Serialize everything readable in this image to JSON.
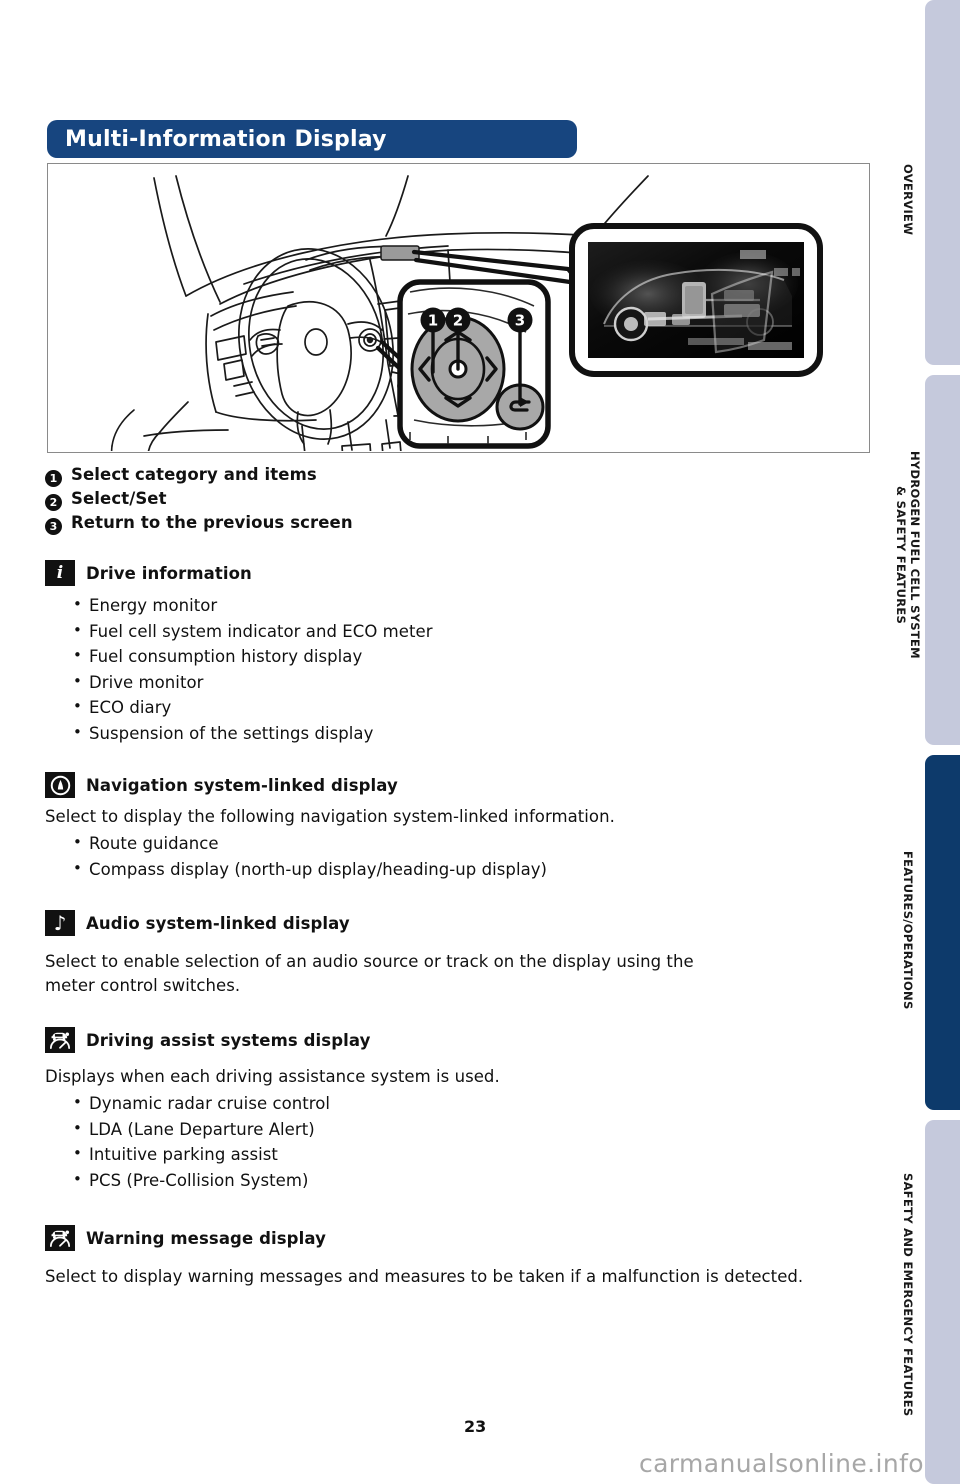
{
  "page": {
    "number": "23",
    "watermark": "carmanualsonline.info"
  },
  "header": {
    "title": "Multi-Information Display",
    "banner_color": "#17457f"
  },
  "figure": {
    "name": "instrument-panel-and-meter-control-switch-illustration",
    "callout_numbers": [
      "1",
      "2",
      "3"
    ],
    "screen_caption": "Energy monitor screen on multi-information display"
  },
  "callouts": [
    {
      "num": "1",
      "text": "Select category and items"
    },
    {
      "num": "2",
      "text": "Select/Set"
    },
    {
      "num": "3",
      "text": "Return to the previous screen"
    }
  ],
  "sections": [
    {
      "id": "drive-information",
      "icon": "info-icon",
      "icon_glyph": "i",
      "title": "Drive information",
      "paragraphs": [],
      "bullets": [
        "Energy monitor",
        "Fuel cell system indicator and ECO meter",
        "Fuel consumption history display",
        "Drive monitor",
        "ECO diary",
        "Suspension of the settings display"
      ]
    },
    {
      "id": "navigation-system-linked-display",
      "icon": "compass-icon",
      "icon_glyph": "",
      "title": "Navigation system-linked display",
      "paragraphs": [
        "Select to display the following navigation system-linked information."
      ],
      "bullets": [
        "Route guidance",
        "Compass display (north-up display/heading-up display)"
      ]
    },
    {
      "id": "audio-system-linked-display",
      "icon": "music-note-icon",
      "icon_glyph": "♪",
      "title": "Audio system-linked display",
      "paragraphs": [
        "Select to enable selection of an audio source or track on the display using the meter control switches."
      ],
      "bullets": []
    },
    {
      "id": "driving-assist-systems-display",
      "icon": "driving-assist-icon",
      "icon_glyph": "",
      "title": "Driving assist systems display",
      "paragraphs": [
        "Displays when each driving assistance system is used."
      ],
      "bullets": [
        "Dynamic radar cruise control",
        "LDA (Lane Departure Alert)",
        "Intuitive parking assist",
        "PCS (Pre-Collision System)"
      ]
    },
    {
      "id": "warning-message-display",
      "icon": "warning-message-icon",
      "icon_glyph": "",
      "title": "Warning message display",
      "paragraphs": [
        "Select to display warning messages and measures to be taken if a malfunction is detected."
      ],
      "bullets": []
    }
  ],
  "side_tabs": [
    {
      "id": "overview",
      "label": "OVERVIEW",
      "state": "inactive",
      "color": "#c5c9dc"
    },
    {
      "id": "hydrogen-fuel-cell-system-safety-features",
      "label": "HYDROGEN FUEL CELL SYSTEM\n& SAFETY FEATURES",
      "state": "inactive",
      "color": "#c5c9dc"
    },
    {
      "id": "features-operations",
      "label": "FEATURES/OPERATIONS",
      "state": "active",
      "color": "#0d3a6b"
    },
    {
      "id": "safety-and-emergency-features",
      "label": "SAFETY AND EMERGENCY FEATURES",
      "state": "inactive",
      "color": "#c5c9dc"
    }
  ]
}
